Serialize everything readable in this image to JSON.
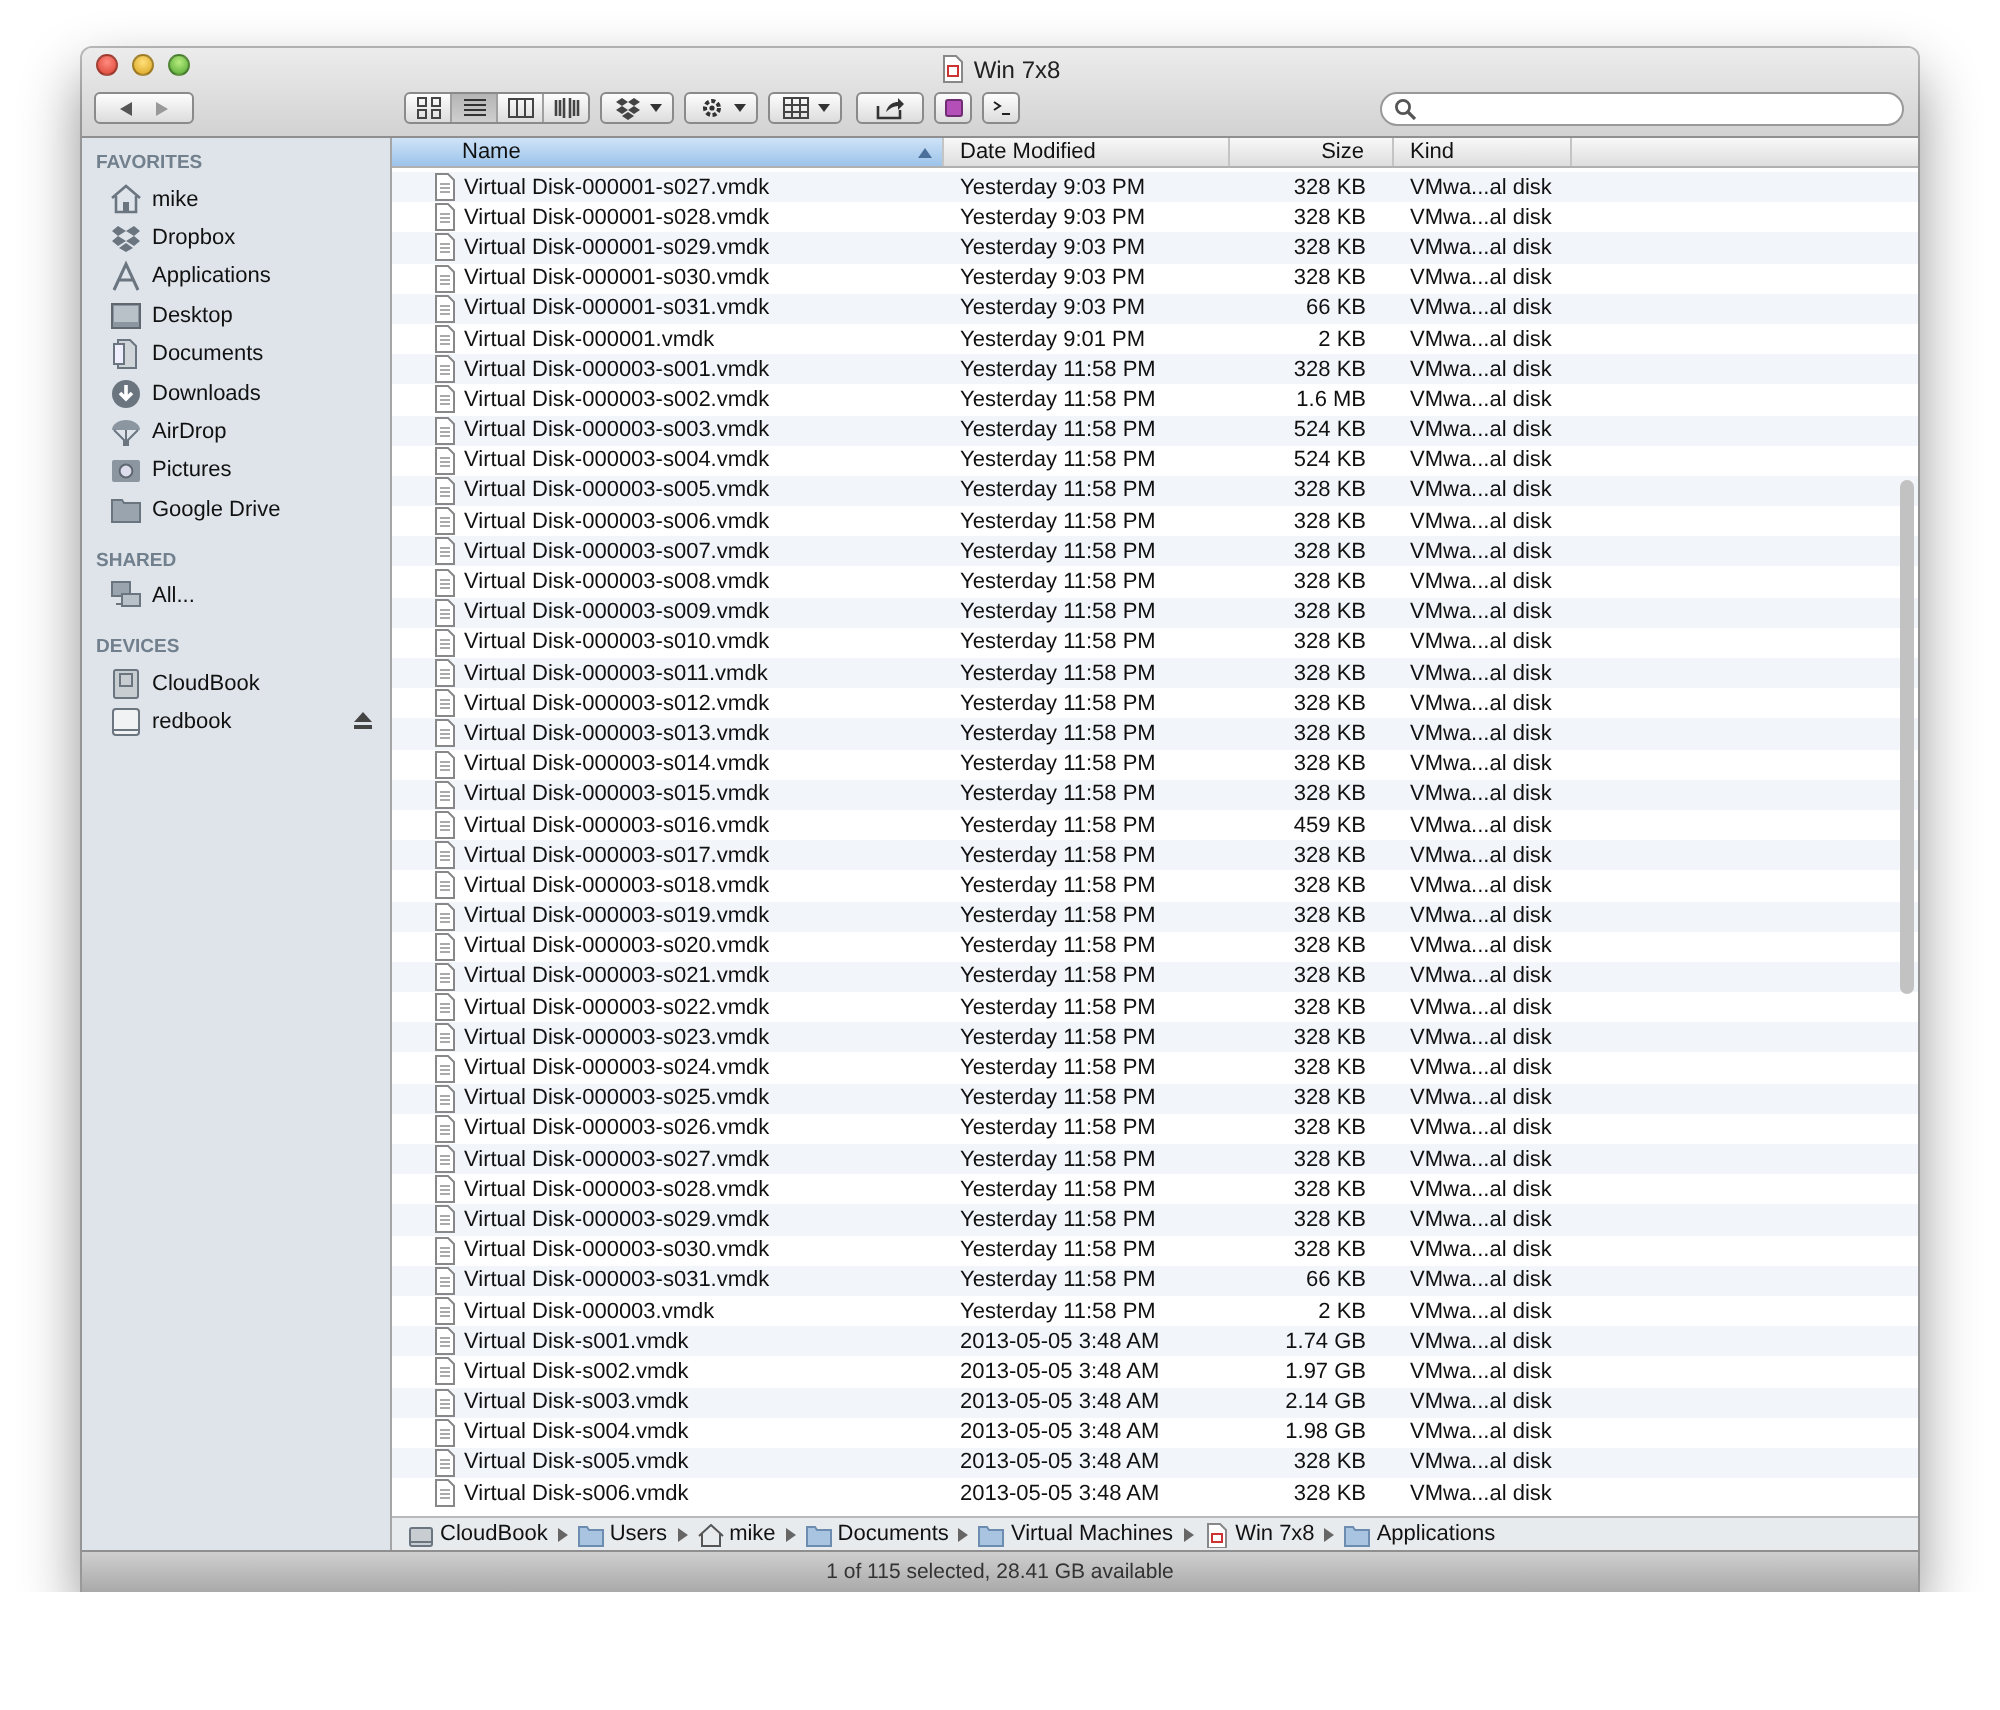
{
  "window": {
    "title": "Win 7x8"
  },
  "sidebar": [
    {
      "heading": "FAVORITES",
      "items": [
        {
          "label": "mike"
        },
        {
          "label": "Dropbox"
        },
        {
          "label": "Applications"
        },
        {
          "label": "Desktop"
        },
        {
          "label": "Documents"
        },
        {
          "label": "Downloads"
        },
        {
          "label": "AirDrop"
        },
        {
          "label": "Pictures"
        },
        {
          "label": "Google Drive"
        }
      ]
    },
    {
      "heading": "SHARED",
      "items": [
        {
          "label": "All..."
        }
      ]
    },
    {
      "heading": "DEVICES",
      "items": [
        {
          "label": "CloudBook"
        },
        {
          "label": "redbook",
          "ejectable": true
        }
      ]
    }
  ],
  "table": {
    "columns": [
      {
        "label": "Name",
        "selected": true
      },
      {
        "label": "Date Modified",
        "selected": false
      },
      {
        "label": "Size",
        "selected": false
      },
      {
        "label": "Kind",
        "selected": false
      }
    ],
    "rows": [
      [
        "Virtual Disk-000001-s027.vmdk",
        "Yesterday 9:03 PM",
        "328 KB",
        "VMwa...al disk"
      ],
      [
        "Virtual Disk-000001-s028.vmdk",
        "Yesterday 9:03 PM",
        "328 KB",
        "VMwa...al disk"
      ],
      [
        "Virtual Disk-000001-s029.vmdk",
        "Yesterday 9:03 PM",
        "328 KB",
        "VMwa...al disk"
      ],
      [
        "Virtual Disk-000001-s030.vmdk",
        "Yesterday 9:03 PM",
        "328 KB",
        "VMwa...al disk"
      ],
      [
        "Virtual Disk-000001-s031.vmdk",
        "Yesterday 9:03 PM",
        "66 KB",
        "VMwa...al disk"
      ],
      [
        "Virtual Disk-000001.vmdk",
        "Yesterday 9:01 PM",
        "2 KB",
        "VMwa...al disk"
      ],
      [
        "Virtual Disk-000003-s001.vmdk",
        "Yesterday 11:58 PM",
        "328 KB",
        "VMwa...al disk"
      ],
      [
        "Virtual Disk-000003-s002.vmdk",
        "Yesterday 11:58 PM",
        "1.6 MB",
        "VMwa...al disk"
      ],
      [
        "Virtual Disk-000003-s003.vmdk",
        "Yesterday 11:58 PM",
        "524 KB",
        "VMwa...al disk"
      ],
      [
        "Virtual Disk-000003-s004.vmdk",
        "Yesterday 11:58 PM",
        "524 KB",
        "VMwa...al disk"
      ],
      [
        "Virtual Disk-000003-s005.vmdk",
        "Yesterday 11:58 PM",
        "328 KB",
        "VMwa...al disk"
      ],
      [
        "Virtual Disk-000003-s006.vmdk",
        "Yesterday 11:58 PM",
        "328 KB",
        "VMwa...al disk"
      ],
      [
        "Virtual Disk-000003-s007.vmdk",
        "Yesterday 11:58 PM",
        "328 KB",
        "VMwa...al disk"
      ],
      [
        "Virtual Disk-000003-s008.vmdk",
        "Yesterday 11:58 PM",
        "328 KB",
        "VMwa...al disk"
      ],
      [
        "Virtual Disk-000003-s009.vmdk",
        "Yesterday 11:58 PM",
        "328 KB",
        "VMwa...al disk"
      ],
      [
        "Virtual Disk-000003-s010.vmdk",
        "Yesterday 11:58 PM",
        "328 KB",
        "VMwa...al disk"
      ],
      [
        "Virtual Disk-000003-s011.vmdk",
        "Yesterday 11:58 PM",
        "328 KB",
        "VMwa...al disk"
      ],
      [
        "Virtual Disk-000003-s012.vmdk",
        "Yesterday 11:58 PM",
        "328 KB",
        "VMwa...al disk"
      ],
      [
        "Virtual Disk-000003-s013.vmdk",
        "Yesterday 11:58 PM",
        "328 KB",
        "VMwa...al disk"
      ],
      [
        "Virtual Disk-000003-s014.vmdk",
        "Yesterday 11:58 PM",
        "328 KB",
        "VMwa...al disk"
      ],
      [
        "Virtual Disk-000003-s015.vmdk",
        "Yesterday 11:58 PM",
        "328 KB",
        "VMwa...al disk"
      ],
      [
        "Virtual Disk-000003-s016.vmdk",
        "Yesterday 11:58 PM",
        "459 KB",
        "VMwa...al disk"
      ],
      [
        "Virtual Disk-000003-s017.vmdk",
        "Yesterday 11:58 PM",
        "328 KB",
        "VMwa...al disk"
      ],
      [
        "Virtual Disk-000003-s018.vmdk",
        "Yesterday 11:58 PM",
        "328 KB",
        "VMwa...al disk"
      ],
      [
        "Virtual Disk-000003-s019.vmdk",
        "Yesterday 11:58 PM",
        "328 KB",
        "VMwa...al disk"
      ],
      [
        "Virtual Disk-000003-s020.vmdk",
        "Yesterday 11:58 PM",
        "328 KB",
        "VMwa...al disk"
      ],
      [
        "Virtual Disk-000003-s021.vmdk",
        "Yesterday 11:58 PM",
        "328 KB",
        "VMwa...al disk"
      ],
      [
        "Virtual Disk-000003-s022.vmdk",
        "Yesterday 11:58 PM",
        "328 KB",
        "VMwa...al disk"
      ],
      [
        "Virtual Disk-000003-s023.vmdk",
        "Yesterday 11:58 PM",
        "328 KB",
        "VMwa...al disk"
      ],
      [
        "Virtual Disk-000003-s024.vmdk",
        "Yesterday 11:58 PM",
        "328 KB",
        "VMwa...al disk"
      ],
      [
        "Virtual Disk-000003-s025.vmdk",
        "Yesterday 11:58 PM",
        "328 KB",
        "VMwa...al disk"
      ],
      [
        "Virtual Disk-000003-s026.vmdk",
        "Yesterday 11:58 PM",
        "328 KB",
        "VMwa...al disk"
      ],
      [
        "Virtual Disk-000003-s027.vmdk",
        "Yesterday 11:58 PM",
        "328 KB",
        "VMwa...al disk"
      ],
      [
        "Virtual Disk-000003-s028.vmdk",
        "Yesterday 11:58 PM",
        "328 KB",
        "VMwa...al disk"
      ],
      [
        "Virtual Disk-000003-s029.vmdk",
        "Yesterday 11:58 PM",
        "328 KB",
        "VMwa...al disk"
      ],
      [
        "Virtual Disk-000003-s030.vmdk",
        "Yesterday 11:58 PM",
        "328 KB",
        "VMwa...al disk"
      ],
      [
        "Virtual Disk-000003-s031.vmdk",
        "Yesterday 11:58 PM",
        "66 KB",
        "VMwa...al disk"
      ],
      [
        "Virtual Disk-000003.vmdk",
        "Yesterday 11:58 PM",
        "2 KB",
        "VMwa...al disk"
      ],
      [
        "Virtual Disk-s001.vmdk",
        "2013-05-05 3:48 AM",
        "1.74 GB",
        "VMwa...al disk"
      ],
      [
        "Virtual Disk-s002.vmdk",
        "2013-05-05 3:48 AM",
        "1.97 GB",
        "VMwa...al disk"
      ],
      [
        "Virtual Disk-s003.vmdk",
        "2013-05-05 3:48 AM",
        "2.14 GB",
        "VMwa...al disk"
      ],
      [
        "Virtual Disk-s004.vmdk",
        "2013-05-05 3:48 AM",
        "1.98 GB",
        "VMwa...al disk"
      ],
      [
        "Virtual Disk-s005.vmdk",
        "2013-05-05 3:48 AM",
        "328 KB",
        "VMwa...al disk"
      ],
      [
        "Virtual Disk-s006.vmdk",
        "2013-05-05 3:48 AM",
        "328 KB",
        "VMwa...al disk"
      ]
    ]
  },
  "path_bar": [
    "CloudBook",
    "Users",
    "mike",
    "Documents",
    "Virtual Machines",
    "Win 7x8",
    "Applications"
  ],
  "status_bar": "1 of 115 selected, 28.41 GB available"
}
